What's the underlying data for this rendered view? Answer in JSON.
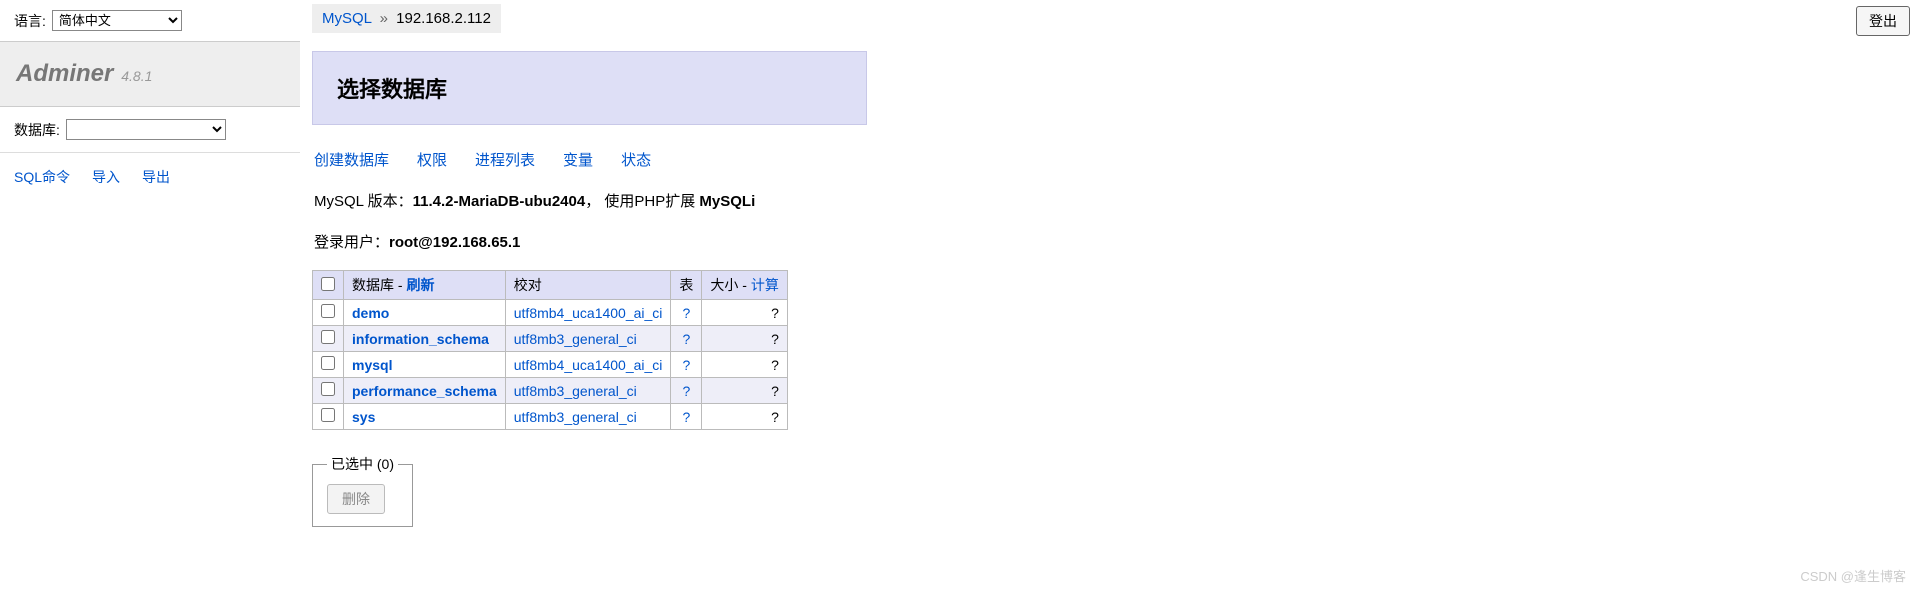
{
  "lang": {
    "label": "语言:",
    "selected": "简体中文"
  },
  "logo": {
    "name": "Adminer",
    "version": "4.8.1"
  },
  "sidebar": {
    "db_label": "数据库:",
    "db_selected": "",
    "links": {
      "sql": "SQL命令",
      "import": "导入",
      "export": "导出"
    }
  },
  "logout_label": "登出",
  "breadcrumb": {
    "driver": "MySQL",
    "sep": "»",
    "host": "192.168.2.112"
  },
  "page_title": "选择数据库",
  "actions": {
    "create_db": "创建数据库",
    "privileges": "权限",
    "processlist": "进程列表",
    "variables": "变量",
    "status": "状态"
  },
  "version_line": {
    "prefix": "MySQL 版本：",
    "version": "11.4.2-MariaDB-ubu2404",
    "comma": "，  使用PHP扩展 ",
    "ext": "MySQLi"
  },
  "user_line": {
    "prefix": "登录用户：",
    "user": "root@192.168.65.1"
  },
  "table": {
    "headers": {
      "db": "数据库",
      "refresh": "刷新",
      "dash": " - ",
      "collation": "校对",
      "tables": "表",
      "size": "大小",
      "compute": "计算"
    },
    "rows": [
      {
        "name": "demo",
        "collation": "utf8mb4_uca1400_ai_ci",
        "tables": "?",
        "size": "?"
      },
      {
        "name": "information_schema",
        "collation": "utf8mb3_general_ci",
        "tables": "?",
        "size": "?"
      },
      {
        "name": "mysql",
        "collation": "utf8mb4_uca1400_ai_ci",
        "tables": "?",
        "size": "?"
      },
      {
        "name": "performance_schema",
        "collation": "utf8mb3_general_ci",
        "tables": "?",
        "size": "?"
      },
      {
        "name": "sys",
        "collation": "utf8mb3_general_ci",
        "tables": "?",
        "size": "?"
      }
    ]
  },
  "selected": {
    "legend": "已选中 (0)",
    "delete": "删除"
  },
  "watermark": "CSDN @逢生博客"
}
